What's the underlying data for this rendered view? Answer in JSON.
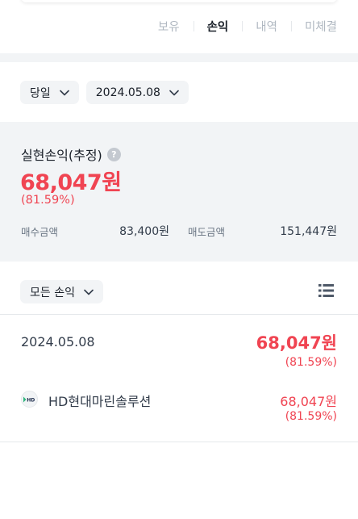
{
  "tabs": [
    {
      "label": "보유",
      "active": false
    },
    {
      "label": "손익",
      "active": true
    },
    {
      "label": "내역",
      "active": false
    },
    {
      "label": "미체결",
      "active": false
    }
  ],
  "filters": {
    "period": "당일",
    "date": "2024.05.08",
    "scope": "모든 손익"
  },
  "summary": {
    "title": "실현손익(추정)",
    "help_icon": "question-circle-icon",
    "amount": "68,047원",
    "rate": "(81.59%)",
    "buy_label": "매수금액",
    "buy_value": "83,400원",
    "sell_label": "매도금액",
    "sell_value": "151,447원"
  },
  "day_group": {
    "date": "2024.05.08",
    "total": "68,047원",
    "rate": "(81.59%)"
  },
  "stocks": [
    {
      "logo_text": "HD",
      "name": "HD현대마린솔루션",
      "pnl": "68,047원",
      "rate": "(81.59%)"
    }
  ],
  "colors": {
    "accent_red": "#f04452",
    "panel_gray": "#f2f4f6",
    "text_dark": "#191f28",
    "text_sub": "#6b7684"
  }
}
